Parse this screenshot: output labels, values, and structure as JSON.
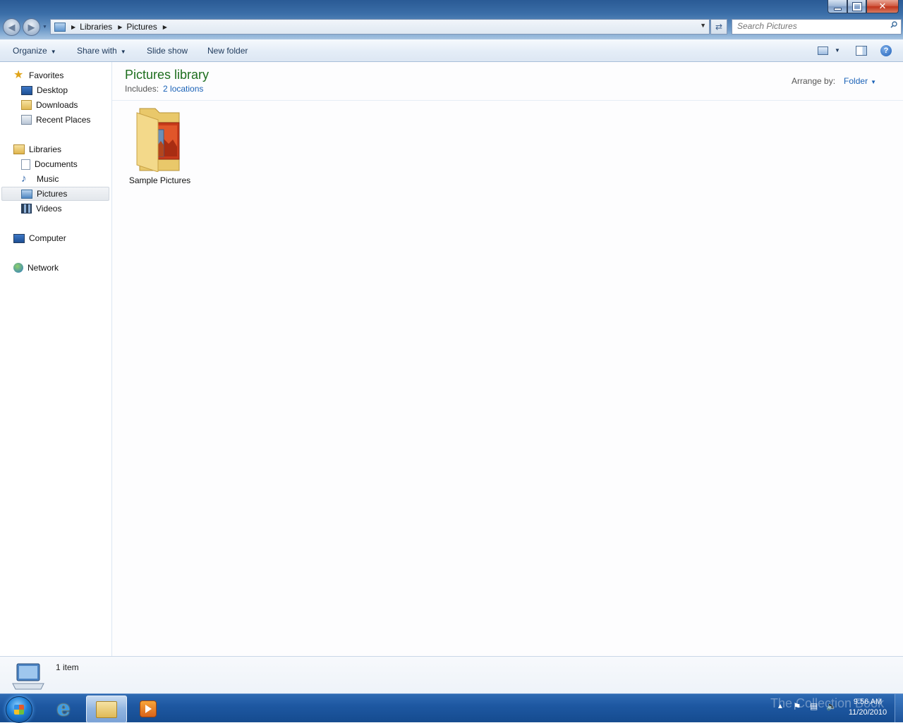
{
  "window": {
    "controls": {
      "min": "",
      "max": "",
      "close": "✕"
    }
  },
  "address": {
    "segments": [
      "Libraries",
      "Pictures"
    ],
    "search_placeholder": "Search Pictures"
  },
  "toolbar": {
    "organize": "Organize",
    "share_with": "Share with",
    "slide_show": "Slide show",
    "new_folder": "New folder",
    "help": "?"
  },
  "nav": {
    "favorites": {
      "label": "Favorites",
      "items": [
        "Desktop",
        "Downloads",
        "Recent Places"
      ]
    },
    "libraries": {
      "label": "Libraries",
      "items": [
        "Documents",
        "Music",
        "Pictures",
        "Videos"
      ],
      "selected": "Pictures"
    },
    "computer": "Computer",
    "network": "Network"
  },
  "content": {
    "title": "Pictures library",
    "includes_label": "Includes:",
    "includes_link": "2 locations",
    "arrange_label": "Arrange by:",
    "arrange_value": "Folder",
    "items": [
      {
        "name": "Sample Pictures",
        "type": "folder"
      }
    ]
  },
  "details": {
    "count": "1 item"
  },
  "taskbar": {
    "pinned": [
      "internet-explorer-icon",
      "windows-explorer-icon",
      "media-player-icon"
    ],
    "active": "windows-explorer-icon",
    "clock_time": "9:56 AM",
    "clock_date": "11/20/2010",
    "watermark": "The Collection Book"
  },
  "colors": {
    "title_green": "#1e6e1e",
    "link_blue": "#1a62b7",
    "taskbar_blue": "#1e58a2"
  }
}
